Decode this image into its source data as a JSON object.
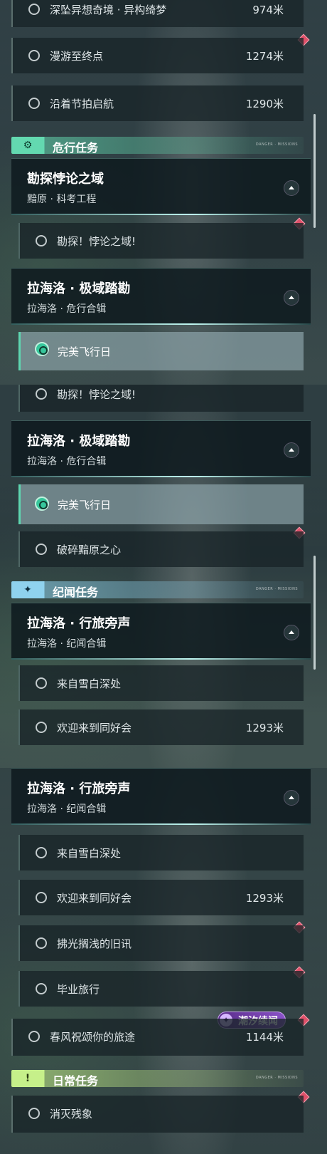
{
  "section_a": {
    "top_rows": [
      {
        "label": "深坠异想奇境 · 异构绮梦",
        "distance": "974米"
      },
      {
        "label": "漫游至终点",
        "distance": "1274米"
      },
      {
        "label": "沿着节拍启航",
        "distance": "1290米"
      }
    ],
    "danger_header": "危行任务",
    "group1": {
      "title": "勘探悖论之域",
      "subtitle": "黯原 · 科考工程"
    },
    "group1_row": "勘探！悖论之域!",
    "group2": {
      "title": "拉海洛 · 极域踏勘",
      "subtitle": "拉海洛 · 危行合辑"
    },
    "group2_row_active": "完美飞行日"
  },
  "section_b": {
    "top_row": "勘探！悖论之域!",
    "group": {
      "title": "拉海洛 · 极域踏勘",
      "subtitle": "拉海洛 · 危行合辑"
    },
    "row_active": "完美飞行日",
    "row2": "破碎黯原之心",
    "journal_header": "纪闻任务",
    "group2": {
      "title": "拉海洛 · 行旅旁声",
      "subtitle": "拉海洛 · 纪闻合辑"
    },
    "rows": [
      {
        "label": "来自雪白深处",
        "distance": ""
      },
      {
        "label": "欢迎来到同好会",
        "distance": "1293米"
      }
    ]
  },
  "section_c": {
    "group": {
      "title": "拉海洛 · 行旅旁声",
      "subtitle": "拉海洛 · 纪闻合辑"
    },
    "rows": [
      {
        "label": "来自雪白深处",
        "distance": ""
      },
      {
        "label": "欢迎来到同好会",
        "distance": "1293米"
      },
      {
        "label": "拂光搁浅的旧讯",
        "distance": ""
      },
      {
        "label": "毕业旅行",
        "distance": ""
      }
    ],
    "badge": "潮汐续闻",
    "row_last": {
      "label": "春风祝颂你的旅途",
      "distance": "1144米"
    },
    "daily_header": "日常任务",
    "daily_row": "消灭残象"
  },
  "header_tag": "DANGER · MISSIONS"
}
